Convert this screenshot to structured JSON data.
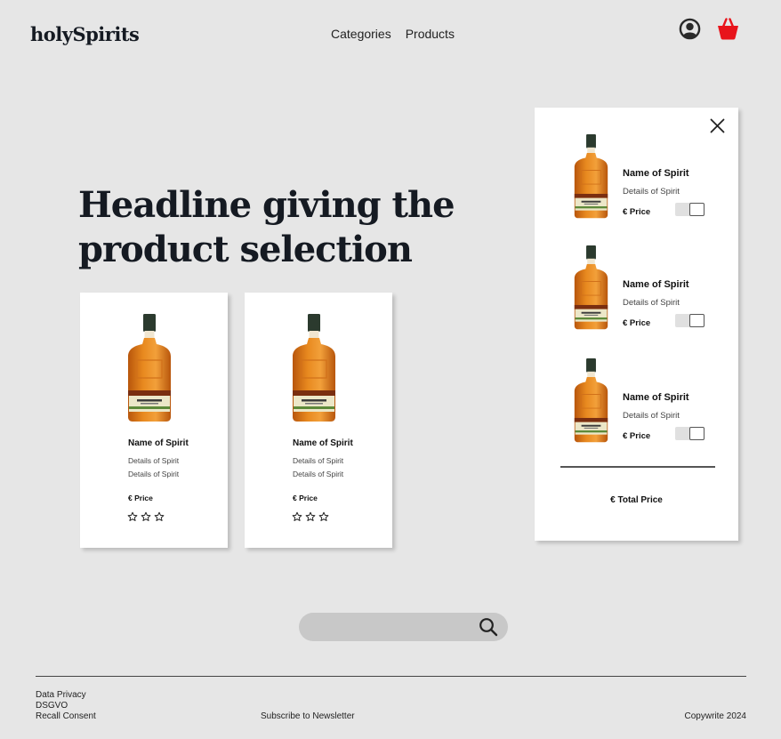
{
  "header": {
    "logo": "holySpirits",
    "nav": [
      "Categories",
      "Products"
    ],
    "icons": [
      "user-circle-icon",
      "shopping-basket-icon"
    ],
    "accent_color": "#e8141b"
  },
  "hero": {
    "headline_line1": "Headline giving the",
    "headline_line2": "product selection"
  },
  "products": [
    {
      "name": "Name of Spirit",
      "details": [
        "Details of Spirit",
        "Details of Spirit"
      ],
      "price": "€ Price",
      "rating": 0,
      "rating_max": 3
    },
    {
      "name": "Name of Spirit",
      "details": [
        "Details of Spirit",
        "Details of Spirit"
      ],
      "price": "€ Price",
      "rating": 0,
      "rating_max": 3
    }
  ],
  "cart": {
    "items": [
      {
        "name": "Name of Spirit",
        "details": "Details of Spirit",
        "price": "€ Price",
        "toggle_on": true
      },
      {
        "name": "Name of Spirit",
        "details": "Details of Spirit",
        "price": "€ Price",
        "toggle_on": true
      },
      {
        "name": "Name of Spirit",
        "details": "Details of Spirit",
        "price": "€ Price",
        "toggle_on": true
      }
    ],
    "total": "€ Total Price"
  },
  "search": {
    "placeholder": ""
  },
  "footer": {
    "links": [
      "Data Privacy",
      "DSGVO",
      "Recall Consent"
    ],
    "newsletter": "Subscribe to Newsletter",
    "copyright": "Copywrite 2024"
  }
}
